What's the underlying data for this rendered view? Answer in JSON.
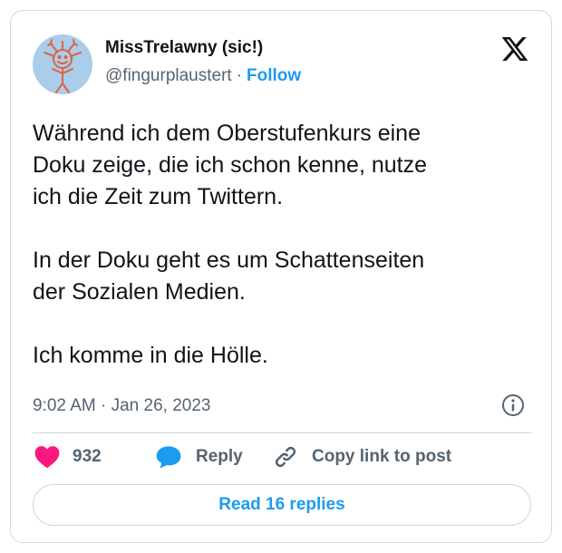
{
  "author": {
    "name": "MissTrelawny (sic!)",
    "handle": "@fingurplaustert",
    "separator": "·",
    "follow_label": "Follow",
    "avatar_icon": "hand-drawn-smiley-avatar"
  },
  "brand_icon": "x-logo-icon",
  "tweet": {
    "text": "Während ich dem Oberstufenkurs eine\nDoku zeige, die ich schon kenne, nutze\nich die Zeit zum Twittern.\n\nIn der Doku geht es um Schattenseiten\nder Sozialen Medien.\n\nIch komme in die Hölle.",
    "timestamp": "9:02 AM · Jan 26, 2023"
  },
  "actions": {
    "like_count": "932",
    "reply_label": "Reply",
    "copy_label": "Copy link to post"
  },
  "read_replies_label": "Read 16 replies",
  "colors": {
    "accent": "#1d9bf0",
    "like": "#f91880",
    "text": "#0f1419",
    "secondary": "#536471",
    "border": "#cfd9de",
    "avatar_bg": "#a9cdea",
    "avatar_drawing": "#e0623d"
  }
}
